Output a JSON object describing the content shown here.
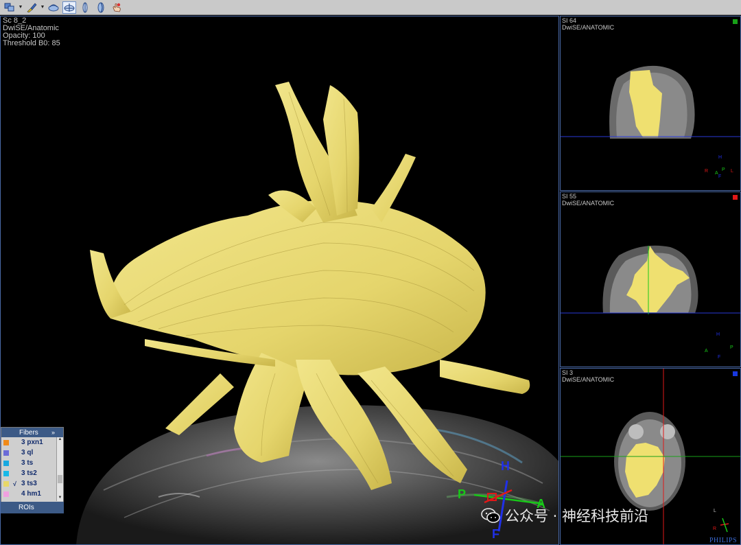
{
  "toolbar": {
    "buttons": [
      {
        "name": "layout-icon"
      },
      {
        "name": "color-brush-icon"
      },
      {
        "name": "fiber-view-icon"
      },
      {
        "name": "sagittal-plane-icon",
        "active": true
      },
      {
        "name": "axial-plane-icon"
      },
      {
        "name": "coronal-plane-icon"
      },
      {
        "name": "hand-pointer-icon"
      }
    ]
  },
  "main_view": {
    "info": {
      "line1": "Sc 8_2",
      "line2": "DwiSE/Anatomic",
      "line3": "Opacity: 100",
      "line4": "Threshold B0: 85"
    },
    "orientation": {
      "h": "H",
      "p": "P",
      "a": "A",
      "f": "F"
    },
    "fiber_color": "#e9dc7a"
  },
  "panels": [
    {
      "title": "SI 64",
      "subtitle": "DwiSE/ANATOMIC",
      "marker_color": "#18a018"
    },
    {
      "title": "SI 55",
      "subtitle": "DwiSE/ANATOMIC",
      "marker_color": "#e01818"
    },
    {
      "title": "SI 3",
      "subtitle": "DwiSE/ANATOMIC",
      "marker_color": "#1838e0"
    }
  ],
  "panel_orientation": {
    "p1": {
      "h": "H",
      "r": "R",
      "l": "L",
      "a": "A",
      "p": "P",
      "f": "F"
    },
    "p2": {
      "h": "H",
      "a": "A",
      "p": "P",
      "f": "F"
    },
    "p3": {
      "r": "R",
      "l": "L"
    }
  },
  "fibers": {
    "header": "Fibers",
    "expand": "»",
    "items": [
      {
        "label": "3 pxn1",
        "color": "#f08a18",
        "checked": false
      },
      {
        "label": "3 ql",
        "color": "#6b6bd8",
        "checked": false
      },
      {
        "label": "3 ts",
        "color": "#18a8e0",
        "checked": false
      },
      {
        "label": "3 ts2",
        "color": "#18b8e8",
        "checked": false
      },
      {
        "label": "3 ts3",
        "color": "#e8d868",
        "checked": true
      },
      {
        "label": "4 hm1",
        "color": "#f0a0e0",
        "checked": false
      }
    ],
    "check_mark": "√",
    "rois": "ROIs"
  },
  "watermark": "公众号 · 神经科技前沿",
  "brand": "PHILIPS"
}
